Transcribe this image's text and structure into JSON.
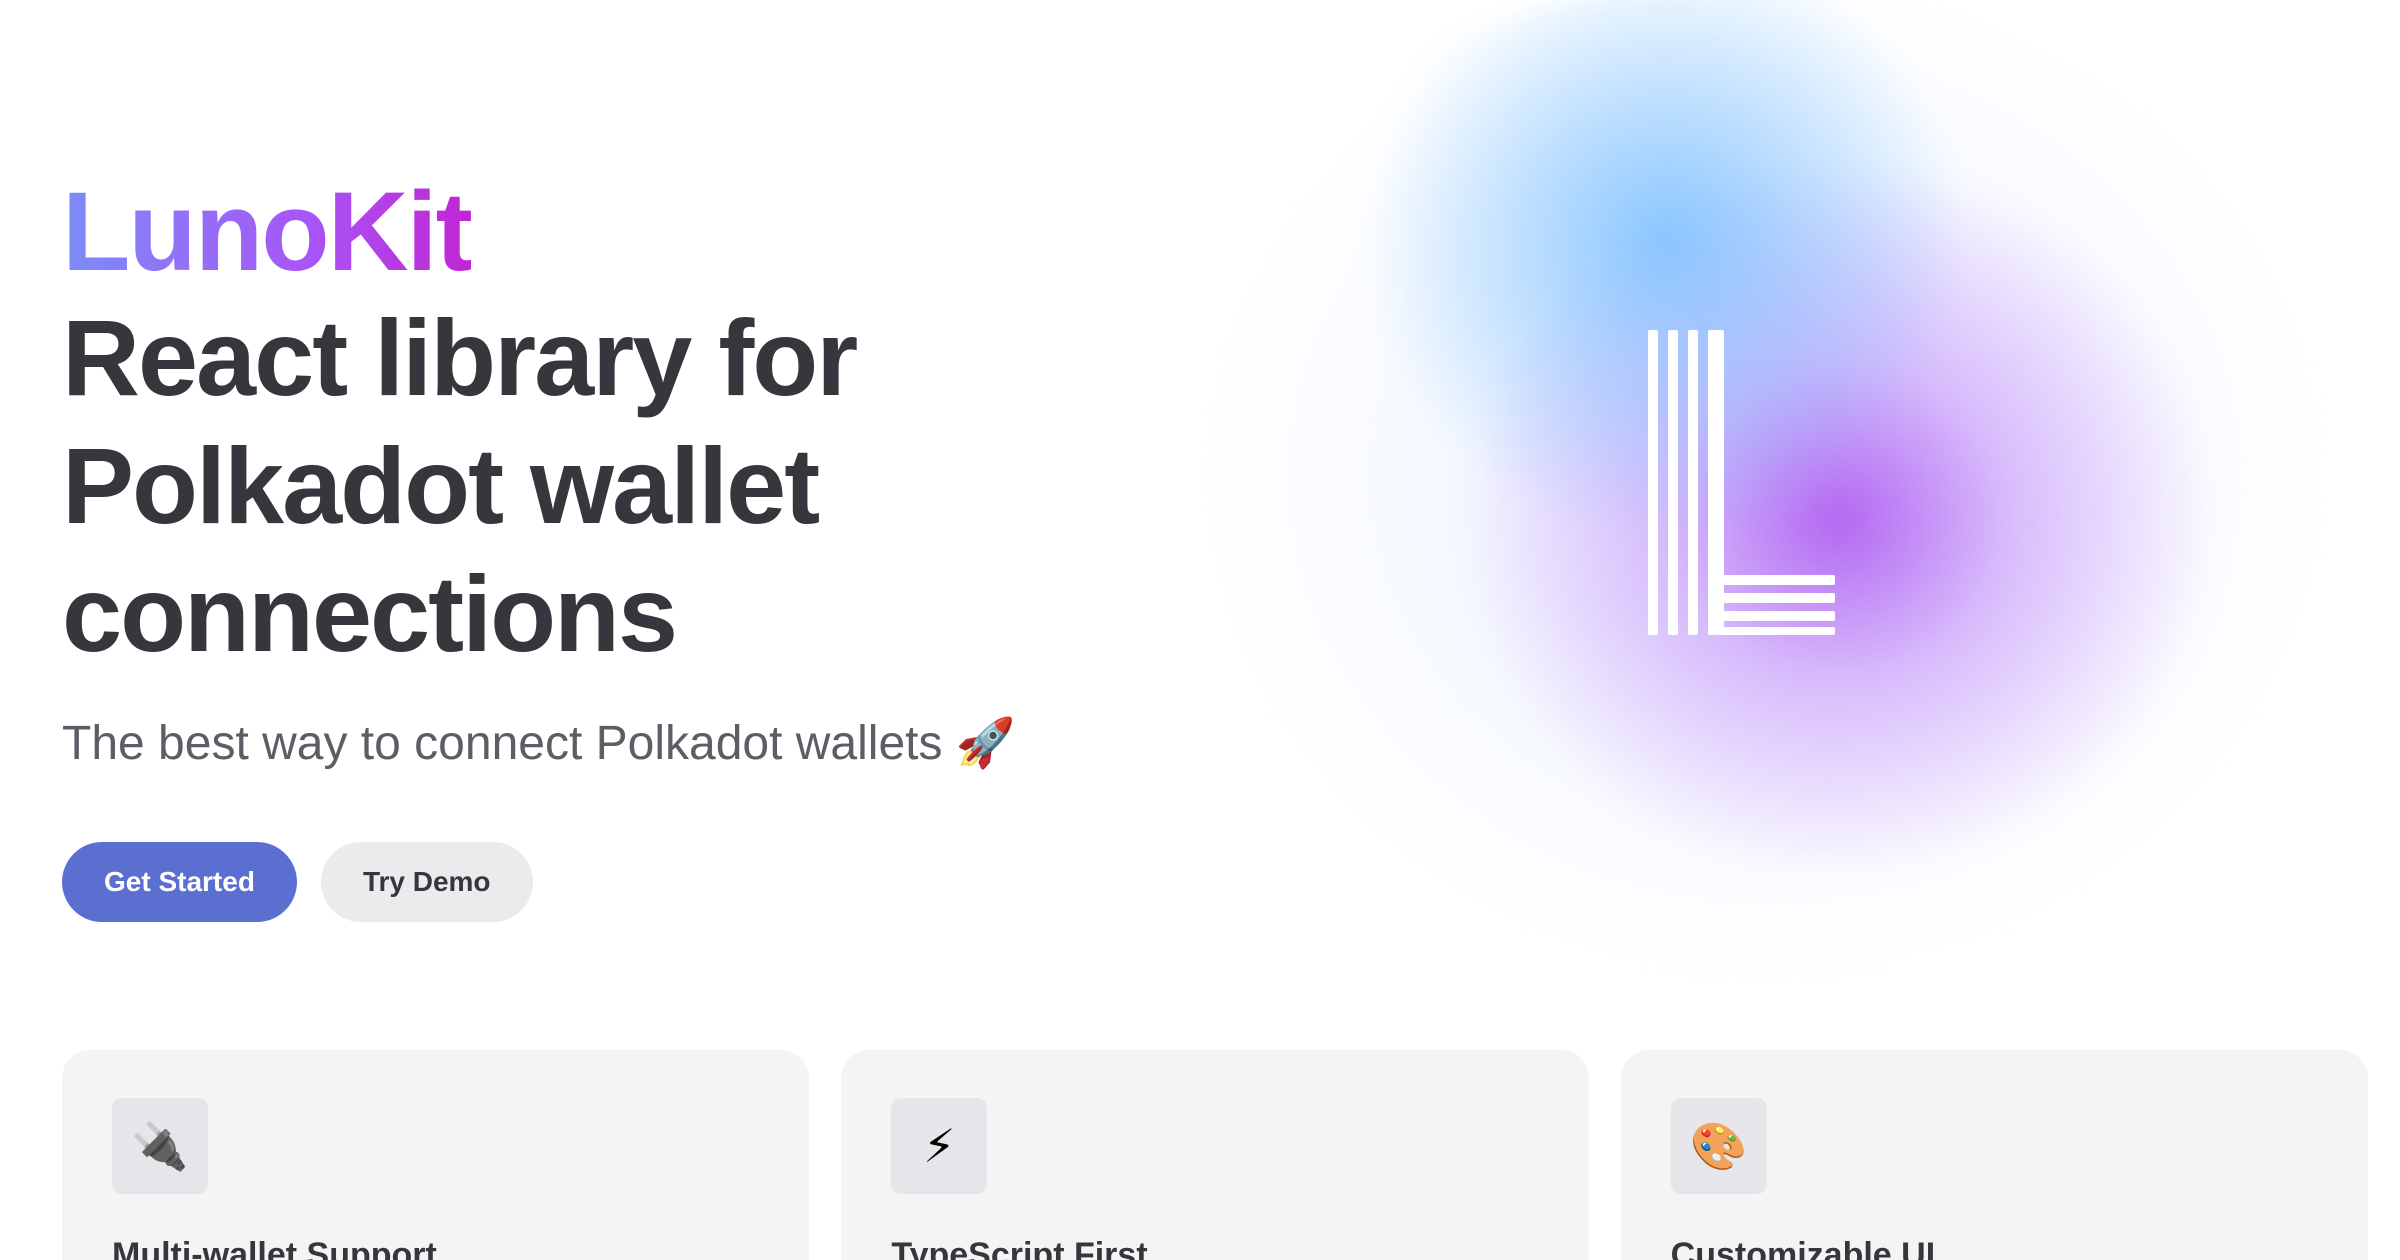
{
  "hero": {
    "brand": "LunoKit",
    "headline": "React library for Polkadot wallet connections",
    "tagline": "The best way to connect Polkadot wallets 🚀"
  },
  "actions": {
    "get_started": "Get Started",
    "try_demo": "Try Demo"
  },
  "logo": {
    "icon": "lunokit-logo-icon",
    "colors": {
      "glow_blue": "#7cc0ff",
      "glow_purple": "#b060f0",
      "mark": "#ffffff"
    }
  },
  "features": [
    {
      "icon": "🔌",
      "title": "Multi-wallet Support"
    },
    {
      "icon": "⚡",
      "title": "TypeScript First"
    },
    {
      "icon": "🎨",
      "title": "Customizable UI"
    }
  ],
  "colors": {
    "brand_gradient_start": "#7c8cf8",
    "brand_gradient_end": "#c026d3",
    "primary_button": "#5b6fd1",
    "heading_text": "#37363d",
    "secondary_button": "#ebebee",
    "card_bg": "#f4f4f5"
  }
}
